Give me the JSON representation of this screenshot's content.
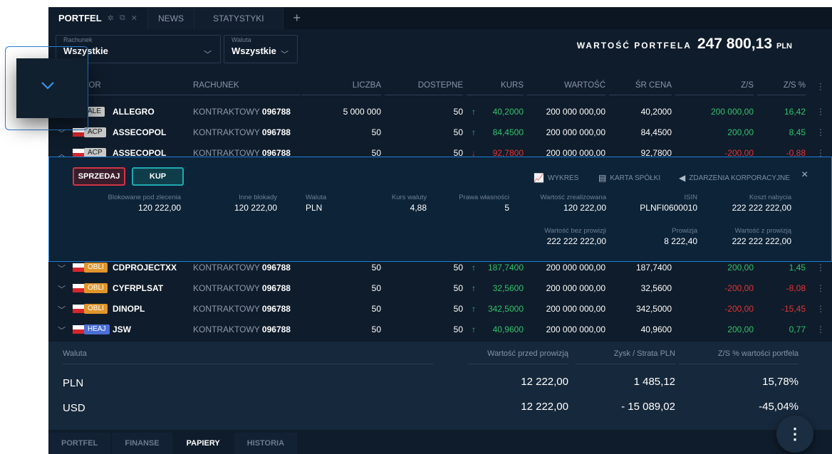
{
  "tabs": [
    {
      "label": "PORTFEL",
      "active": true
    },
    {
      "label": "NEWS"
    },
    {
      "label": "STATYSTYKI"
    }
  ],
  "add_tab": "+",
  "filters": {
    "rachunek": {
      "label": "Rachunek",
      "value": "Wszystkie"
    },
    "waluta": {
      "label": "Waluta",
      "value": "Wszystkie"
    }
  },
  "portfolio": {
    "label": "WARTOŚĆ PORTFELA",
    "value": "247 800,13",
    "currency": "PLN"
  },
  "columns": [
    "LOR",
    "RACHUNEK",
    "LICZBA",
    "DOSTEPNE",
    "KURS",
    "WARTOŚĆ",
    "ŚR CENA",
    "Z/S",
    "Z/S %"
  ],
  "rows": [
    {
      "badge": "ALE",
      "badge_color": "#c9c9c9",
      "symbol": "ALLEGRO",
      "account_type": "KONTRAKTOWY",
      "account_no": "096788",
      "qty": "5 000 000",
      "available": "50",
      "dir": "up",
      "rate": "40,2000",
      "value": "200 000 000,00",
      "avg": "40,2000",
      "pl": "200 000,00",
      "plpct": "16,42",
      "pl_dir": "up"
    },
    {
      "badge": "ACP",
      "badge_color": "#c9c9c9",
      "symbol": "ASSECOPOL",
      "account_type": "KONTRAKTOWY",
      "account_no": "096788",
      "qty": "50",
      "available": "50",
      "dir": "up",
      "rate": "84,4500",
      "value": "200 000 000,00",
      "avg": "84,4500",
      "pl": "200,00",
      "plpct": "8,45",
      "pl_dir": "up"
    },
    {
      "badge": "ACP",
      "badge_color": "#c9c9c9",
      "symbol": "ASSECOPOL",
      "account_type": "KONTRAKTOWY",
      "account_no": "096788",
      "qty": "50",
      "available": "50",
      "dir": "down",
      "rate": "92,7800",
      "value": "200 000 000,00",
      "avg": "92,7800",
      "pl": "-200,00",
      "plpct": "-0,88",
      "pl_dir": "down"
    },
    {
      "badge": "OBLI",
      "badge_color": "#e0962b",
      "symbol": "CDPROJECTXX",
      "account_type": "KONTRAKTOWY",
      "account_no": "096788",
      "qty": "50",
      "available": "50",
      "dir": "up",
      "rate": "187,7400",
      "value": "200 000 000,00",
      "avg": "187,7400",
      "pl": "200,00",
      "plpct": "1,45",
      "pl_dir": "up"
    },
    {
      "badge": "OBLI",
      "badge_color": "#e0962b",
      "symbol": "CYFRPLSAT",
      "account_type": "KONTRAKTOWY",
      "account_no": "096788",
      "qty": "50",
      "available": "50",
      "dir": "up",
      "rate": "32,5600",
      "value": "200 000 000,00",
      "avg": "32,5600",
      "pl": "-200,00",
      "plpct": "-8,08",
      "pl_dir": "down"
    },
    {
      "badge": "OBLI",
      "badge_color": "#e0962b",
      "symbol": "DINOPL",
      "account_type": "KONTRAKTOWY",
      "account_no": "096788",
      "qty": "50",
      "available": "50",
      "dir": "up",
      "rate": "342,5000",
      "value": "200 000 000,00",
      "avg": "342,5000",
      "pl": "-200,00",
      "plpct": "-15,45",
      "pl_dir": "down"
    },
    {
      "badge": "HEAJ",
      "badge_color": "#4a6fd6",
      "symbol": "JSW",
      "account_type": "KONTRAKTOWY",
      "account_no": "096788",
      "qty": "50",
      "available": "50",
      "dir": "up",
      "rate": "40,9600",
      "value": "200 000 000,00",
      "avg": "40,9600",
      "pl": "200,00",
      "plpct": "0,77",
      "pl_dir": "up"
    }
  ],
  "detail": {
    "sell": "SPRZEDAJ",
    "buy": "KUP",
    "links": [
      "WYKRES",
      "KARTA SPÓŁKI",
      "ZDARZENIA KORPORACYJNE"
    ],
    "close": "×",
    "fields": [
      {
        "label": "Blokowane pod zlecenia",
        "value": "120 222,00"
      },
      {
        "label": "Inne blokady",
        "value": "120 222,00"
      },
      {
        "label": "Waluta",
        "value": "PLN"
      },
      {
        "label": "Kurs waluty",
        "value": "4,88"
      },
      {
        "label": "Prawa własności",
        "value": "5"
      },
      {
        "label": "Wartość zrealizowana",
        "value": "120 222,00"
      },
      {
        "label": "ISIN",
        "value": "PLNFI0600010"
      },
      {
        "label": "Koszt nabycia",
        "value": "222 222 222,00"
      },
      {
        "label": "Wartość bez prowizji",
        "value": "222 222 222,00"
      },
      {
        "label": "Prowizja",
        "value": "8 222,40"
      },
      {
        "label": "Wartość z prowizją",
        "value": "222 222 222,00"
      }
    ]
  },
  "summary": {
    "headers": [
      "Waluta",
      "Wartość przed prowizją",
      "Zysk / Strata PLN",
      "Z/S % wartości portfela"
    ],
    "rows": [
      {
        "currency": "PLN",
        "value": "12 222,00",
        "pl": "1 485,12",
        "pct": "15,78%",
        "dir": "up"
      },
      {
        "currency": "USD",
        "value": "12 222,00",
        "pl": "- 15 089,02",
        "pct": "-45,04%",
        "dir": "down"
      }
    ]
  },
  "bottom_tabs": [
    {
      "label": "PORTFEL"
    },
    {
      "label": "FINANSE"
    },
    {
      "label": "PAPIERY",
      "active": true
    },
    {
      "label": "HISTORIA"
    }
  ],
  "fab_glyph": "⋮",
  "colors": {
    "bg": "#0f1c2b",
    "up": "#2ec46a",
    "down": "#e33434",
    "accent": "#1f7ed8"
  }
}
